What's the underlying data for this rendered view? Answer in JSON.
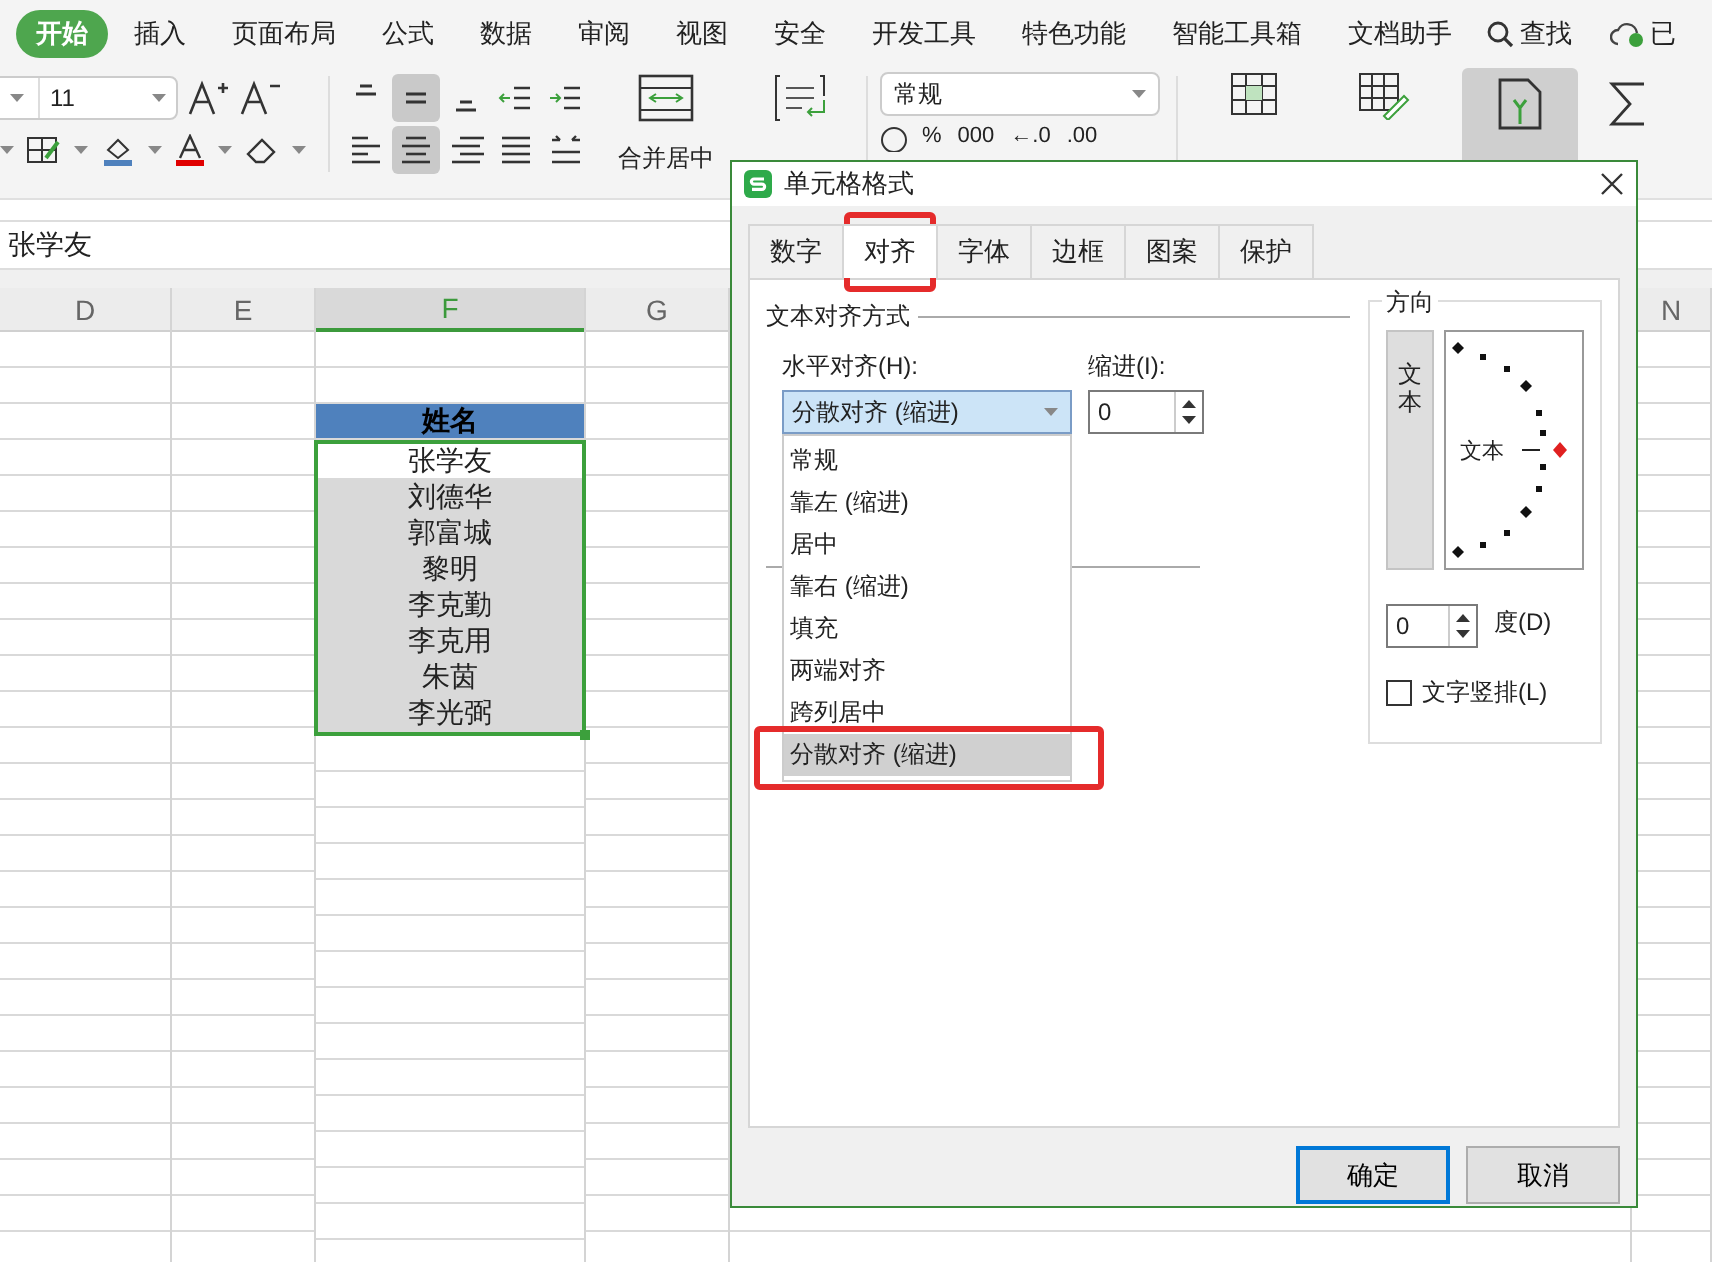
{
  "ribbon_tabs": [
    {
      "label": "开始",
      "selected": true
    },
    {
      "label": "插入",
      "selected": false
    },
    {
      "label": "页面布局",
      "selected": false
    },
    {
      "label": "公式",
      "selected": false
    },
    {
      "label": "数据",
      "selected": false
    },
    {
      "label": "审阅",
      "selected": false
    },
    {
      "label": "视图",
      "selected": false
    },
    {
      "label": "安全",
      "selected": false
    },
    {
      "label": "开发工具",
      "selected": false
    },
    {
      "label": "特色功能",
      "selected": false
    },
    {
      "label": "智能工具箱",
      "selected": false
    },
    {
      "label": "文档助手",
      "selected": false
    }
  ],
  "search": {
    "label": "查找"
  },
  "cloud_status": "已",
  "ribbon": {
    "font_size": "11",
    "vertical_align": [
      {
        "selected": false
      },
      {
        "selected": true
      },
      {
        "selected": false
      }
    ],
    "horizontal_align": [
      {
        "selected": false
      },
      {
        "selected": true
      },
      {
        "selected": false
      },
      {
        "selected": false
      }
    ],
    "merge_label": "合并居中",
    "number_format": "常规",
    "number_buttons": [
      "%",
      "000",
      "←.0",
      ".00"
    ]
  },
  "formula_bar": {
    "value": "张学友"
  },
  "columns": [
    {
      "label": "D",
      "selected": false
    },
    {
      "label": "E",
      "selected": false
    },
    {
      "label": "F",
      "selected": true
    },
    {
      "label": "G",
      "selected": false
    },
    {
      "label": "N",
      "selected": false
    }
  ],
  "table": {
    "header": "姓名",
    "rows": [
      {
        "name": "张学友",
        "active": true
      },
      {
        "name": "刘德华",
        "active": false
      },
      {
        "name": "郭富城",
        "active": false
      },
      {
        "name": "黎明",
        "active": false
      },
      {
        "name": "李克勤",
        "active": false
      },
      {
        "name": "李克用",
        "active": false
      },
      {
        "name": "朱茵",
        "active": false
      },
      {
        "name": "李光弼",
        "active": false
      }
    ]
  },
  "dialog": {
    "title": "单元格格式",
    "tabs": [
      {
        "label": "数字",
        "selected": false,
        "highlighted": false
      },
      {
        "label": "对齐",
        "selected": true,
        "highlighted": true
      },
      {
        "label": "字体",
        "selected": false,
        "highlighted": false
      },
      {
        "label": "边框",
        "selected": false,
        "highlighted": false
      },
      {
        "label": "图案",
        "selected": false,
        "highlighted": false
      },
      {
        "label": "保护",
        "selected": false,
        "highlighted": false
      }
    ],
    "text_alignment": {
      "title": "文本对齐方式",
      "horizontal": {
        "label": "水平对齐(H):",
        "value": "分散对齐 (缩进)",
        "options": [
          {
            "label": "常规",
            "selected": false,
            "highlighted": false
          },
          {
            "label": "靠左 (缩进)",
            "selected": false,
            "highlighted": false
          },
          {
            "label": "居中",
            "selected": false,
            "highlighted": false
          },
          {
            "label": "靠右 (缩进)",
            "selected": false,
            "highlighted": false
          },
          {
            "label": "填充",
            "selected": false,
            "highlighted": false
          },
          {
            "label": "两端对齐",
            "selected": false,
            "highlighted": false
          },
          {
            "label": "跨列居中",
            "selected": false,
            "highlighted": false
          },
          {
            "label": "分散对齐 (缩进)",
            "selected": true,
            "highlighted": true
          }
        ]
      },
      "indent": {
        "label": "缩进(I):",
        "value": "0"
      }
    },
    "orientation": {
      "title": "方向",
      "vertical_text": "文本",
      "dial_text": "文本",
      "degrees": {
        "value": "0",
        "label": "度(D)"
      },
      "vertical_checkbox": {
        "label": "文字竖排(L)",
        "checked": false
      }
    },
    "buttons": [
      {
        "label": "确定",
        "kind": "primary"
      },
      {
        "label": "取消",
        "kind": "normal"
      }
    ]
  }
}
